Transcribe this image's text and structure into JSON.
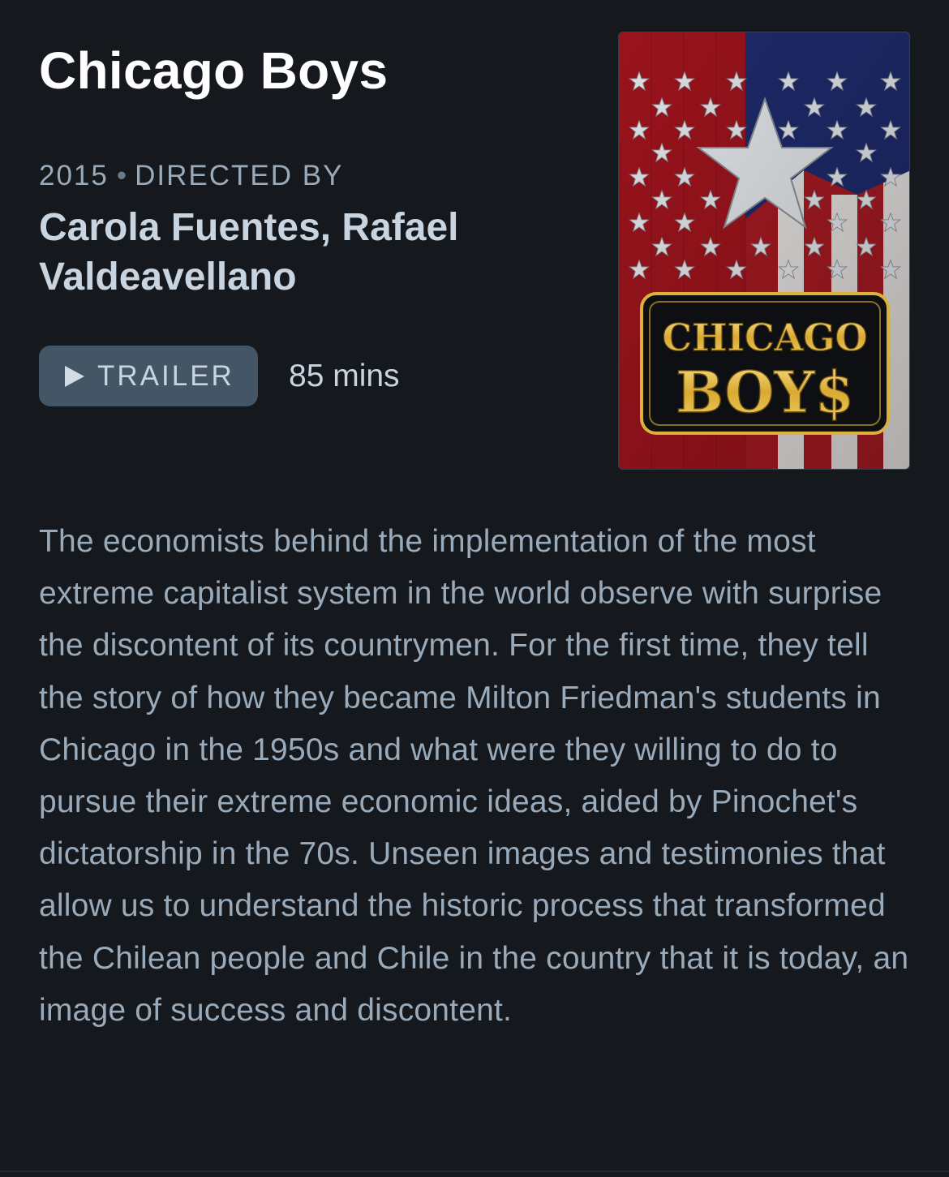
{
  "film": {
    "title": "Chicago Boys",
    "year": "2015",
    "separator": "•",
    "directed_by_label": "DIRECTED BY",
    "directors": "Carola Fuentes, Rafael Valdeavellano",
    "trailer_label": "TRAILER",
    "runtime": "85 mins",
    "poster": {
      "icon": "film-poster",
      "title_line_1": "CHICAGO",
      "title_line_2": "BOY$"
    },
    "synopsis": "The economists behind the implementation of the most extreme capitalist system in the world observe with surprise the discontent of its countrymen. For the first time, they tell the story of how they became Milton Friedman's students in Chicago in the 1950s and what were they willing to do to pursue their extreme economic ideas, aided by Pinochet's dictatorship in the 70s. Unseen images and testimonies that allow us to understand the historic process that transformed the Chilean people and Chile in the country that it is today, an image of success and discontent."
  },
  "colors": {
    "background": "#15181c",
    "title": "#ffffff",
    "meta": "#99aabb",
    "directors": "#c8d4e0",
    "button_bg": "#445566",
    "flag_red": "#a4161f",
    "flag_blue": "#1f2b6e",
    "poster_gold": "#e6c04a"
  }
}
